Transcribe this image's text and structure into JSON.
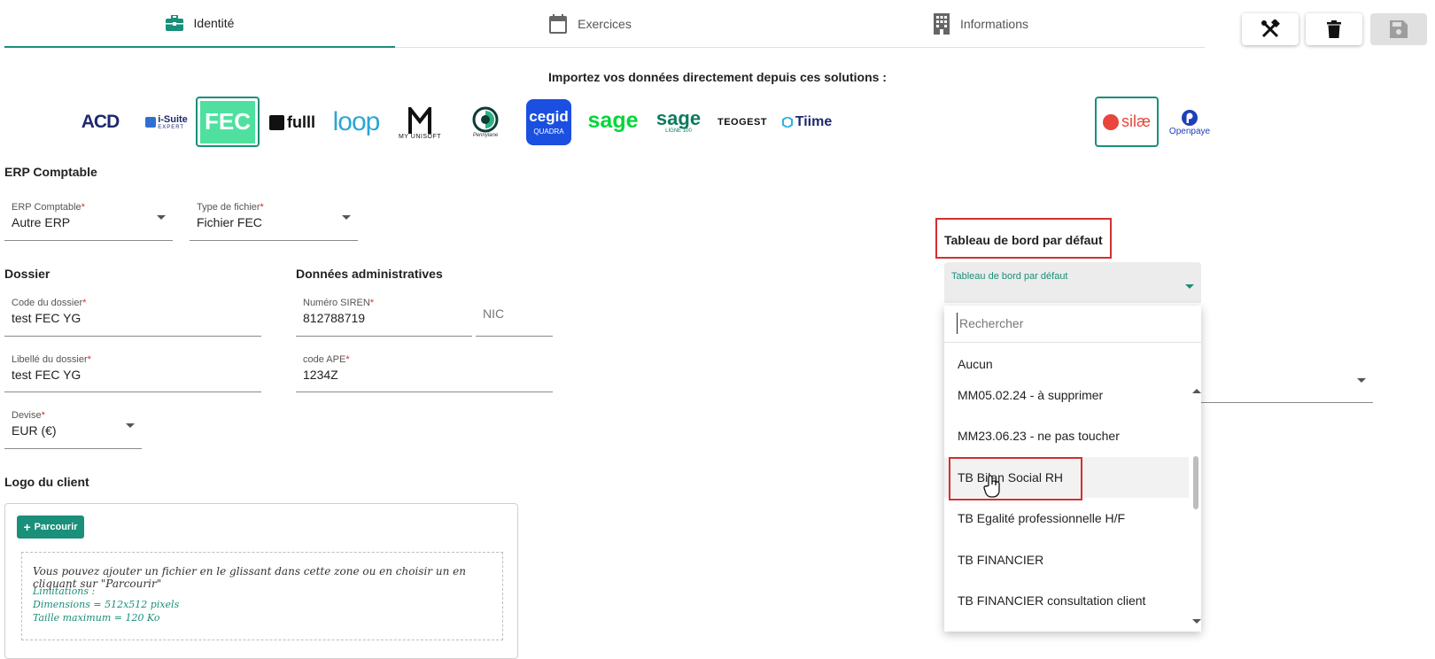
{
  "tabs": [
    {
      "label": "Identité",
      "icon": "briefcase-icon",
      "active": true
    },
    {
      "label": "Exercices",
      "icon": "calendar-icon",
      "active": false
    },
    {
      "label": "Informations",
      "icon": "building-icon",
      "active": false
    }
  ],
  "toolbar": {
    "tools_icon": "tools-icon",
    "delete_icon": "trash-icon",
    "save_icon": "save-icon"
  },
  "import": {
    "title": "Importez vos données directement depuis ces solutions :",
    "logos": {
      "acd": "ACD",
      "isuite_main": "i-Suite",
      "isuite_sub": "EXPERT",
      "fec": "FEC",
      "fulll": "fulll",
      "loop": "loop",
      "myunisoft": "MY UNISOFT",
      "pennylane": "Pennylane",
      "cegid": "cegid",
      "cegid_sub": "QUADRA",
      "sage": "sage",
      "sage100": "sage",
      "sage100_sub": "LIGNE 100",
      "teogest": "TEOGEST",
      "tiime": "Tiime",
      "silae": "silæ",
      "openpaye": "Openpaye"
    }
  },
  "erp": {
    "section_title": "ERP Comptable",
    "erp_label": "ERP Comptable",
    "erp_value": "Autre ERP",
    "file_label": "Type de fichier",
    "file_value": "Fichier FEC"
  },
  "dossier": {
    "section_title": "Dossier",
    "code_label": "Code du dossier",
    "code_value": "test FEC YG",
    "libelle_label": "Libellé du dossier",
    "libelle_value": "test FEC YG",
    "devise_label": "Devise",
    "devise_value": "EUR (€)"
  },
  "admin": {
    "section_title": "Données administratives",
    "siren_label": "Numéro SIREN",
    "siren_value": "812788719",
    "nic_placeholder": "NIC",
    "ape_label": "code APE",
    "ape_value": "1234Z"
  },
  "required_mark": "*",
  "dashboard": {
    "section_title": "Tableau de bord par défaut",
    "field_label": "Tableau de bord par défaut",
    "search_placeholder": "Rechercher",
    "options": [
      "Aucun",
      "MM05.02.24 - à supprimer",
      "MM23.06.23 - ne pas toucher",
      "TB Bilan Social RH",
      "TB Egalité professionnelle H/F",
      "TB FINANCIER",
      "TB FINANCIER consultation client"
    ]
  },
  "logo_client": {
    "section_title": "Logo du client",
    "browse_label": "Parcourir",
    "instructions": "Vous pouvez ajouter un fichier en le glissant dans cette zone ou en choisir un en cliquant sur \"Parcourir\"",
    "limitations_title": "Limitations :",
    "dimensions": "Dimensions = 512x512 pixels",
    "max_size": "Taille maximum = 120 Ko"
  },
  "colors": {
    "accent": "#1a8f7a",
    "required": "#d32f2f",
    "highlight": "#d32f2f"
  }
}
